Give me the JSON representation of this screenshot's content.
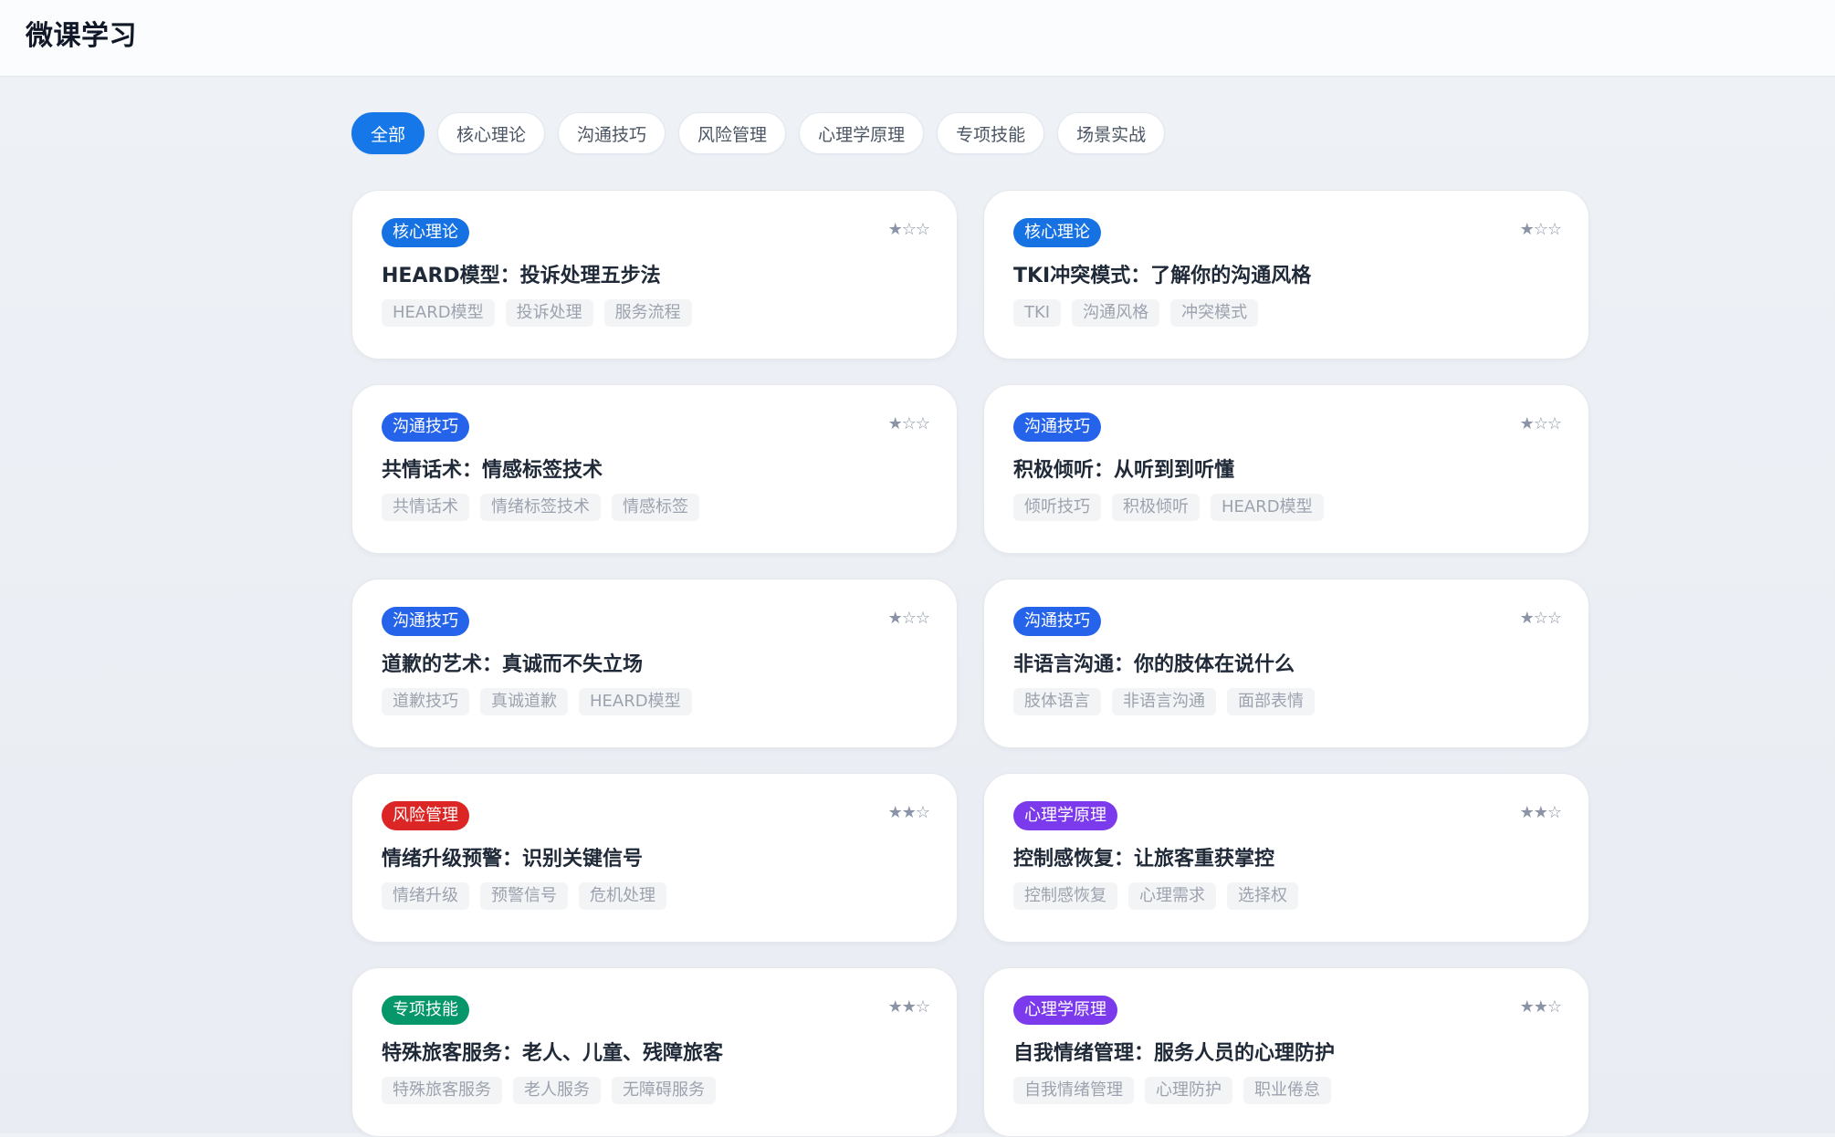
{
  "app": {
    "title": "微课学习"
  },
  "filters": [
    {
      "label": "全部",
      "active": true
    },
    {
      "label": "核心理论",
      "active": false
    },
    {
      "label": "沟通技巧",
      "active": false
    },
    {
      "label": "风险管理",
      "active": false
    },
    {
      "label": "心理学原理",
      "active": false
    },
    {
      "label": "专项技能",
      "active": false
    },
    {
      "label": "场景实战",
      "active": false
    }
  ],
  "category_colors": {
    "核心理论": "#1672e3",
    "沟通技巧": "#2563eb",
    "风险管理": "#dc2626",
    "心理学原理": "#7c3aed",
    "专项技能": "#059669"
  },
  "courses": [
    {
      "category": "核心理论",
      "stars": "★☆☆",
      "title": "HEARD模型：投诉处理五步法",
      "tags": [
        "HEARD模型",
        "投诉处理",
        "服务流程"
      ]
    },
    {
      "category": "核心理论",
      "stars": "★☆☆",
      "title": "TKI冲突模式：了解你的沟通风格",
      "tags": [
        "TKI",
        "沟通风格",
        "冲突模式"
      ]
    },
    {
      "category": "沟通技巧",
      "stars": "★☆☆",
      "title": "共情话术：情感标签技术",
      "tags": [
        "共情话术",
        "情绪标签技术",
        "情感标签"
      ]
    },
    {
      "category": "沟通技巧",
      "stars": "★☆☆",
      "title": "积极倾听：从听到到听懂",
      "tags": [
        "倾听技巧",
        "积极倾听",
        "HEARD模型"
      ]
    },
    {
      "category": "沟通技巧",
      "stars": "★☆☆",
      "title": "道歉的艺术：真诚而不失立场",
      "tags": [
        "道歉技巧",
        "真诚道歉",
        "HEARD模型"
      ]
    },
    {
      "category": "沟通技巧",
      "stars": "★☆☆",
      "title": "非语言沟通：你的肢体在说什么",
      "tags": [
        "肢体语言",
        "非语言沟通",
        "面部表情"
      ]
    },
    {
      "category": "风险管理",
      "stars": "★★☆",
      "title": "情绪升级预警：识别关键信号",
      "tags": [
        "情绪升级",
        "预警信号",
        "危机处理"
      ]
    },
    {
      "category": "心理学原理",
      "stars": "★★☆",
      "title": "控制感恢复：让旅客重获掌控",
      "tags": [
        "控制感恢复",
        "心理需求",
        "选择权"
      ]
    },
    {
      "category": "专项技能",
      "stars": "★★☆",
      "title": "特殊旅客服务：老人、儿童、残障旅客",
      "tags": [
        "特殊旅客服务",
        "老人服务",
        "无障碍服务"
      ]
    },
    {
      "category": "心理学原理",
      "stars": "★★☆",
      "title": "自我情绪管理：服务人员的心理防护",
      "tags": [
        "自我情绪管理",
        "心理防护",
        "职业倦怠"
      ]
    }
  ]
}
